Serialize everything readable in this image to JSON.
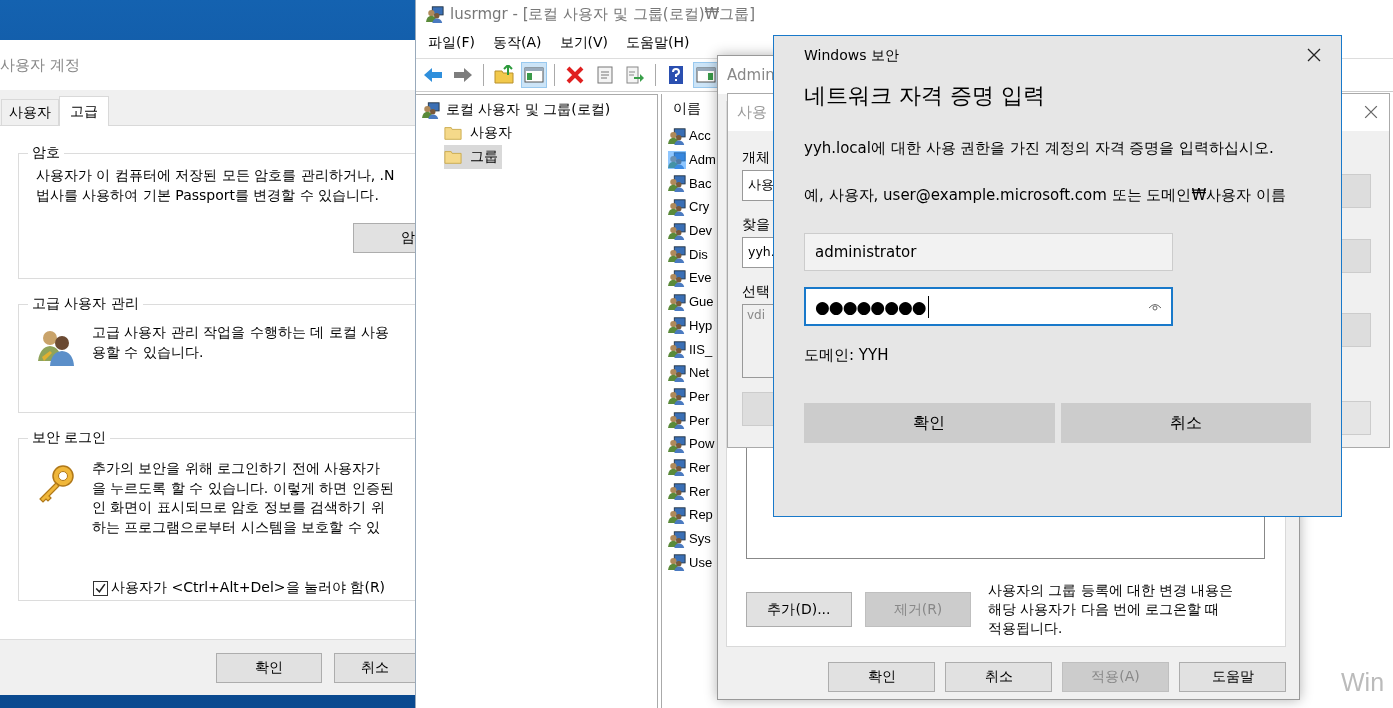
{
  "user_accounts_window": {
    "title": "사용자 계정",
    "tabs": [
      {
        "label": "사용자",
        "selected": false
      },
      {
        "label": "고급",
        "selected": true
      }
    ],
    "groups": [
      {
        "kind": "password",
        "title": "암호",
        "text_lines": [
          "사용자가 이 컴퓨터에 저장된 모든 암호를 관리하거나, .N",
          "법사를 사용하여 기본 Passport를 변경할 수 있습니다."
        ],
        "button": "암"
      },
      {
        "kind": "advanced",
        "title": "고급 사용자 관리",
        "text_lines": [
          "고급 사용자 관리 작업을 수행하는 데 로컬 사용",
          "용할 수 있습니다."
        ]
      },
      {
        "kind": "secure_logon",
        "title": "보안 로그인",
        "text_lines": [
          "추가의 보안을 위해 로그인하기 전에 사용자가",
          "을 누르도록 할 수 있습니다. 이렇게 하면 인증된",
          "인 화면이 표시되므로 암호 정보를 검색하기 위",
          "하는 프로그램으로부터 시스템을 보호할 수 있"
        ],
        "checkbox": {
          "label": "사용자가 <Ctrl+Alt+Del>을 눌러야 함(R)",
          "checked": true
        }
      }
    ],
    "buttons": [
      "확인",
      "취소"
    ]
  },
  "lusrmgr_window": {
    "title": "lusrmgr - [로컬 사용자 및 그룹(로컬)₩그룹]",
    "menu": [
      "파일(F)",
      "동작(A)",
      "보기(V)",
      "도움말(H)"
    ],
    "toolbar": [
      {
        "kind": "back",
        "pressed": false
      },
      {
        "kind": "forward",
        "pressed": false
      },
      {
        "kind": "separator"
      },
      {
        "kind": "up",
        "pressed": false
      },
      {
        "kind": "pane",
        "pressed": true
      },
      {
        "kind": "separator"
      },
      {
        "kind": "delete",
        "pressed": false
      },
      {
        "kind": "properties",
        "pressed": false
      },
      {
        "kind": "export",
        "pressed": false
      },
      {
        "kind": "separator"
      },
      {
        "kind": "help",
        "pressed": false
      },
      {
        "kind": "action_pane",
        "pressed": true
      }
    ],
    "tree": {
      "label": "로컬 사용자 및 그룹(로컬)",
      "children": [
        {
          "label": "사용자",
          "selected": false
        },
        {
          "label": "그룹",
          "selected": true
        }
      ]
    },
    "list": {
      "column": "이름",
      "rows": [
        {
          "name": "Acc",
          "selected": false
        },
        {
          "name": "Adm",
          "selected": true
        },
        {
          "name": "Bac",
          "selected": false
        },
        {
          "name": "Cry",
          "selected": false
        },
        {
          "name": "Dev",
          "selected": false
        },
        {
          "name": "Dis",
          "selected": false
        },
        {
          "name": "Eve",
          "selected": false
        },
        {
          "name": "Gue",
          "selected": false
        },
        {
          "name": "Hyp",
          "selected": false
        },
        {
          "name": "IIS_",
          "selected": false
        },
        {
          "name": "Net",
          "selected": false
        },
        {
          "name": "Per",
          "selected": false
        },
        {
          "name": "Per",
          "selected": false
        },
        {
          "name": "Pow",
          "selected": false
        },
        {
          "name": "Rer",
          "selected": false
        },
        {
          "name": "Rer",
          "selected": false
        },
        {
          "name": "Rep",
          "selected": false
        },
        {
          "name": "Sys",
          "selected": false
        },
        {
          "name": "Use",
          "selected": false
        }
      ]
    }
  },
  "properties_window": {
    "title": "Admin",
    "member_buttons": [
      {
        "label": "추가(D)...",
        "disabled": false
      },
      {
        "label": "제거(R)",
        "disabled": true
      }
    ],
    "note_lines": [
      "사용자의 그룹 등록에 대한 변경 내용은",
      "해당 사용자가 다음 번에 로그온할 때",
      "적용됩니다."
    ],
    "buttons": [
      {
        "label": "확인",
        "disabled": false
      },
      {
        "label": "취소",
        "disabled": false
      },
      {
        "label": "적용(A)",
        "disabled": true
      },
      {
        "label": "도움말",
        "disabled": false
      }
    ]
  },
  "select_users_dialog": {
    "title": "사용",
    "fields": [
      {
        "kind": "input",
        "label": "개체",
        "value": "사용"
      },
      {
        "kind": "input",
        "label": "찾을",
        "value": "yyh."
      },
      {
        "kind": "textarea",
        "label": "선택",
        "placeholder": "vdi"
      }
    ]
  },
  "credential_dialog": {
    "title": "Windows 보안",
    "heading": "네트워크 자격 증명 입력",
    "message": "yyh.local에 대한 사용 권한을 가진 계정의 자격 증명을 입력하십시오.",
    "example": "예, 사용자, user@example.microsoft.com 또는 도메인₩사용자 이름",
    "username": "administrator",
    "password": "●●●●●●●●",
    "domain": "도메인: YYH",
    "buttons": [
      "확인",
      "취소"
    ]
  },
  "desktop": {
    "activation_text": "Win"
  }
}
